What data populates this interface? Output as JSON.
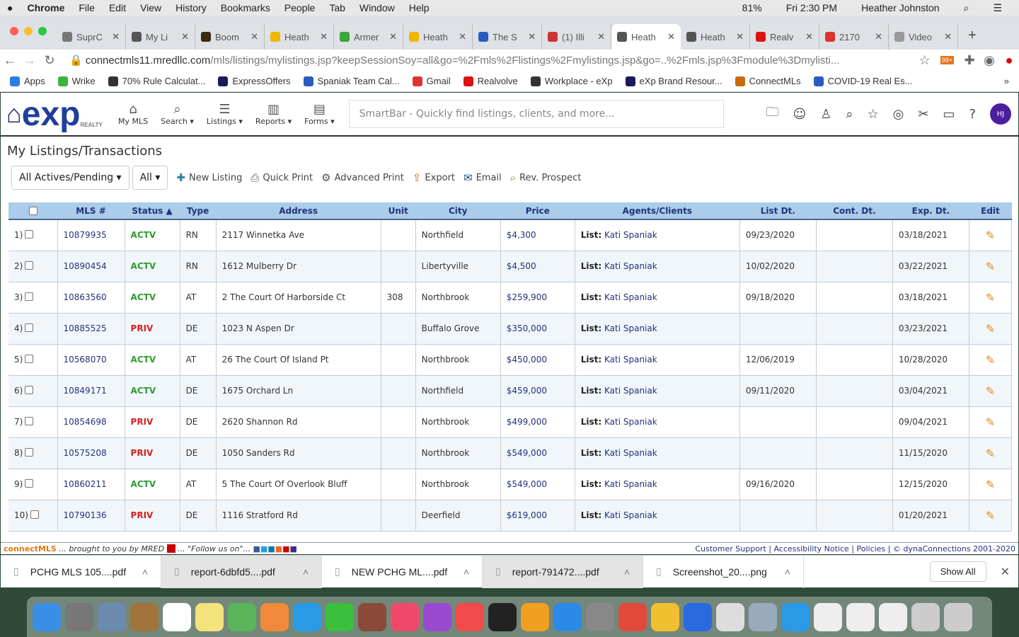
{
  "menubar": {
    "apple": "",
    "app": "Chrome",
    "items": [
      "File",
      "Edit",
      "View",
      "History",
      "Bookmarks",
      "People",
      "Tab",
      "Window",
      "Help"
    ],
    "battery": "81%",
    "clock": "Fri 2:30 PM",
    "user": "Heather Johnston"
  },
  "tabs": [
    {
      "title": "SuprC",
      "color": "#777"
    },
    {
      "title": "My Li",
      "color": "#555"
    },
    {
      "title": "Boom",
      "color": "#3a2a10"
    },
    {
      "title": "Heath",
      "color": "#f2b600"
    },
    {
      "title": "Armer",
      "color": "#3aa53a"
    },
    {
      "title": "Heath",
      "color": "#f2b600"
    },
    {
      "title": "The S",
      "color": "#2a5bc0"
    },
    {
      "title": "(1) Illi",
      "color": "#c33"
    },
    {
      "title": "Heath",
      "color": "#555",
      "active": true
    },
    {
      "title": "Heath",
      "color": "#555"
    },
    {
      "title": "Realv",
      "color": "#d11"
    },
    {
      "title": "2170",
      "color": "#d33"
    },
    {
      "title": "Video",
      "color": "#999"
    }
  ],
  "address": {
    "url_host": "connectmls11.mredllc.com",
    "url_path": "/mls/listings/mylistings.jsp?keepSessionSoy=all&go=%2Fmls%2Flistings%2Fmylistings.jsp&go=..%2Fmls.jsp%3Fmodule%3Dmylisti...",
    "badge": "99+"
  },
  "bookmarks": [
    {
      "label": "Apps",
      "color": "#2a7de1"
    },
    {
      "label": "Wrike",
      "color": "#3ab53a"
    },
    {
      "label": "70% Rule Calculat...",
      "color": "#333"
    },
    {
      "label": "ExpressOffers",
      "color": "#1a1a5a"
    },
    {
      "label": "Spaniak Team Cal...",
      "color": "#2a5bc0"
    },
    {
      "label": "Gmail",
      "color": "#d33"
    },
    {
      "label": "Realvolve",
      "color": "#d11"
    },
    {
      "label": "Workplace - eXp",
      "color": "#333"
    },
    {
      "label": "eXp Brand Resour...",
      "color": "#1a1a5a"
    },
    {
      "label": "ConnectMLs",
      "color": "#c86a10"
    },
    {
      "label": "COVID-19 Real Es...",
      "color": "#2a5bc0"
    }
  ],
  "app": {
    "logo": "exp",
    "logo_sub": "REALTY",
    "nav": [
      {
        "label": "My MLS",
        "icon": "home-icon"
      },
      {
        "label": "Search ▾",
        "icon": "search-icon"
      },
      {
        "label": "Listings ▾",
        "icon": "list-icon"
      },
      {
        "label": "Reports ▾",
        "icon": "bar-chart-icon"
      },
      {
        "label": "Forms ▾",
        "icon": "document-icon"
      }
    ],
    "smartbar_placeholder": "SmartBar - Quickly find listings, clients, and more...",
    "avatar": "HJ"
  },
  "page_title": "My Listings/Transactions",
  "toolbar": {
    "filter": "All Actives/Pending",
    "filter2": "All",
    "actions": [
      "New Listing",
      "Quick Print",
      "Advanced Print",
      "Export",
      "Email",
      "Rev. Prospect"
    ]
  },
  "table": {
    "headers": [
      "MLS #",
      "Status ▲",
      "Type",
      "Address",
      "Unit",
      "City",
      "Price",
      "Agents/Clients",
      "List Dt.",
      "Cont. Dt.",
      "Exp. Dt.",
      "Edit"
    ],
    "rows": [
      {
        "n": "1)",
        "mls": "10879935",
        "status": "ACTV",
        "type": "RN",
        "address": "2117 Winnetka Ave",
        "unit": "",
        "city": "Northfield",
        "price": "$4,300",
        "agent_label": "List:",
        "agent": "Kati Spaniak",
        "list_dt": "09/23/2020",
        "cont_dt": "",
        "exp_dt": "03/18/2021"
      },
      {
        "n": "2)",
        "mls": "10890454",
        "status": "ACTV",
        "type": "RN",
        "address": "1612 Mulberry Dr",
        "unit": "",
        "city": "Libertyville",
        "price": "$4,500",
        "agent_label": "List:",
        "agent": "Kati Spaniak",
        "list_dt": "10/02/2020",
        "cont_dt": "",
        "exp_dt": "03/22/2021"
      },
      {
        "n": "3)",
        "mls": "10863560",
        "status": "ACTV",
        "type": "AT",
        "address": "2 The Court Of Harborside Ct",
        "unit": "308",
        "city": "Northbrook",
        "price": "$259,900",
        "agent_label": "List:",
        "agent": "Kati Spaniak",
        "list_dt": "09/18/2020",
        "cont_dt": "",
        "exp_dt": "03/18/2021"
      },
      {
        "n": "4)",
        "mls": "10885525",
        "status": "PRIV",
        "type": "DE",
        "address": "1023 N Aspen Dr",
        "unit": "",
        "city": "Buffalo Grove",
        "price": "$350,000",
        "agent_label": "List:",
        "agent": "Kati Spaniak",
        "list_dt": "",
        "cont_dt": "",
        "exp_dt": "03/23/2021"
      },
      {
        "n": "5)",
        "mls": "10568070",
        "status": "ACTV",
        "type": "AT",
        "address": "26 The Court Of Island Pt",
        "unit": "",
        "city": "Northbrook",
        "price": "$450,000",
        "agent_label": "List:",
        "agent": "Kati Spaniak",
        "list_dt": "12/06/2019",
        "cont_dt": "",
        "exp_dt": "10/28/2020"
      },
      {
        "n": "6)",
        "mls": "10849171",
        "status": "ACTV",
        "type": "DE",
        "address": "1675 Orchard Ln",
        "unit": "",
        "city": "Northfield",
        "price": "$459,000",
        "agent_label": "List:",
        "agent": "Kati Spaniak",
        "list_dt": "09/11/2020",
        "cont_dt": "",
        "exp_dt": "03/04/2021"
      },
      {
        "n": "7)",
        "mls": "10854698",
        "status": "PRIV",
        "type": "DE",
        "address": "2620 Shannon Rd",
        "unit": "",
        "city": "Northbrook",
        "price": "$499,000",
        "agent_label": "List:",
        "agent": "Kati Spaniak",
        "list_dt": "",
        "cont_dt": "",
        "exp_dt": "09/04/2021"
      },
      {
        "n": "8)",
        "mls": "10575208",
        "status": "PRIV",
        "type": "DE",
        "address": "1050 Sanders Rd",
        "unit": "",
        "city": "Northbrook",
        "price": "$549,000",
        "agent_label": "List:",
        "agent": "Kati Spaniak",
        "list_dt": "",
        "cont_dt": "",
        "exp_dt": "11/15/2020"
      },
      {
        "n": "9)",
        "mls": "10860211",
        "status": "ACTV",
        "type": "AT",
        "address": "5 The Court Of Overlook Bluff",
        "unit": "",
        "city": "Northbrook",
        "price": "$549,000",
        "agent_label": "List:",
        "agent": "Kati Spaniak",
        "list_dt": "09/16/2020",
        "cont_dt": "",
        "exp_dt": "12/15/2020"
      },
      {
        "n": "10)",
        "mls": "10790136",
        "status": "PRIV",
        "type": "DE",
        "address": "1116 Stratford Rd",
        "unit": "",
        "city": "Deerfield",
        "price": "$619,000",
        "agent_label": "List:",
        "agent": "Kati Spaniak",
        "list_dt": "",
        "cont_dt": "",
        "exp_dt": "01/20/2021"
      }
    ]
  },
  "footer": {
    "brand": "connectMLS",
    "tagline": "... brought to you by MRED",
    "follow": "... \"Follow us on\"...",
    "links": "Customer Support | Accessibility Notice | Policies | © dynaConnections 2001-2020"
  },
  "downloads": {
    "items": [
      "PCHG MLS 105....pdf",
      "report-6dbfd5....pdf",
      "NEW PCHG ML....pdf",
      "report-791472....pdf",
      "Screenshot_20....png"
    ],
    "show_all": "Show All"
  },
  "dock_colors": [
    "#3a8ee6",
    "#777",
    "#6a8ab0",
    "#a0743a",
    "#fff",
    "#f4e27a",
    "#5ab55a",
    "#f08a3a",
    "#2a9ae6",
    "#3ac03a",
    "#8a4a3a",
    "#f04a6a",
    "#9a4ad0",
    "#f04a4a",
    "#222",
    "#f0a020",
    "#2a8ae6",
    "#888",
    "#e04a3a",
    "#f0c030",
    "#2a6ae0",
    "#ddd",
    "#9ab",
    "#2a9ae6",
    "#eee",
    "#eee",
    "#eee",
    "#ccc",
    "#ccc"
  ]
}
